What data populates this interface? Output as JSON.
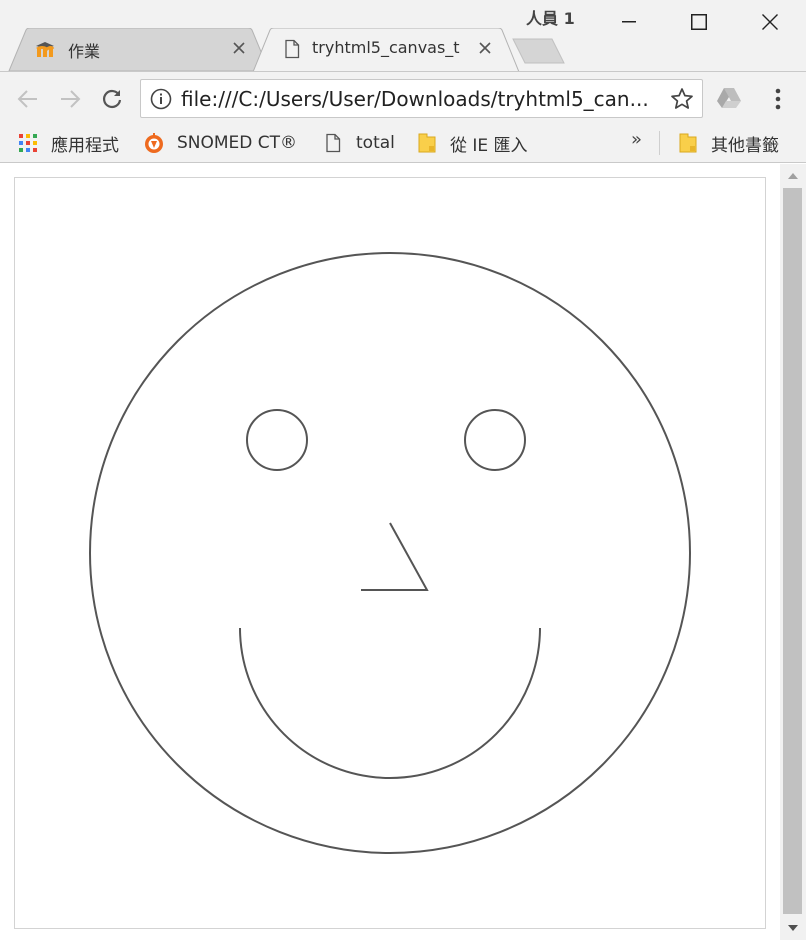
{
  "window": {
    "profile_label": "人員 1",
    "controls": [
      "minimize",
      "maximize",
      "close"
    ]
  },
  "tabs": [
    {
      "title": "作業",
      "icon": "moodle-icon",
      "active": false
    },
    {
      "title": "tryhtml5_canvas_t",
      "icon": "document-icon",
      "active": true
    }
  ],
  "toolbar": {
    "url": "file:///C:/Users/User/Downloads/tryhtml5_can..."
  },
  "bookmarks": {
    "items": [
      {
        "label": "應用程式",
        "icon": "apps-grid-icon"
      },
      {
        "label": "SNOMED CT®",
        "icon": "snomed-icon"
      },
      {
        "label": "total",
        "icon": "document-icon"
      },
      {
        "label": "從 IE 匯入",
        "icon": "folder-icon"
      }
    ],
    "overflow_label": "»",
    "other_label": "其他書籤"
  },
  "drawing": {
    "description_shapes": [
      "face-circle",
      "left-eye",
      "right-eye",
      "nose",
      "smile"
    ],
    "stroke_color": "#555555"
  },
  "colors": {
    "chrome": "#f2f2f2",
    "active_tab": "#f2f2f2",
    "inactive_tab": "#d5d5d5",
    "folder": "#f9cf4a",
    "snomed": "#ee6a1f"
  }
}
